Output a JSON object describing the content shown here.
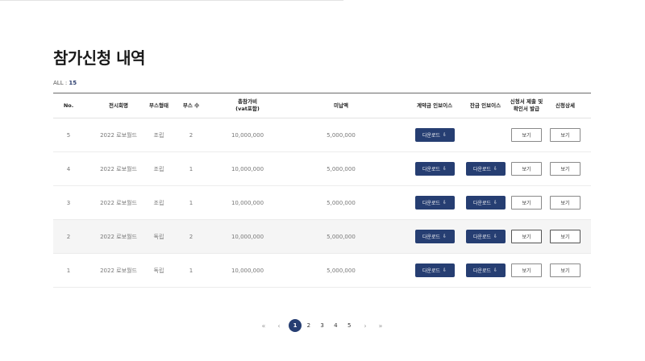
{
  "page": {
    "title": "참가신청 내역"
  },
  "summary": {
    "label": "ALL : ",
    "count": "15"
  },
  "table": {
    "headers": {
      "no": "No.",
      "name": "전시회명",
      "type": "부스형태",
      "count": "부스 수",
      "total_line1": "총참가비",
      "total_line2": "(vat포함)",
      "unpaid": "미납액",
      "inv1": "계약금 인보이스",
      "inv2": "잔금 인보이스",
      "apply_line1": "신청서 제출 및",
      "apply_line2": "확인서 발급",
      "detail": "신청상세"
    },
    "rows": [
      {
        "no": "5",
        "name": "2022 로보월드",
        "type": "조립",
        "count": "2",
        "total": "10,000,000",
        "unpaid": "5,000,000",
        "inv1": "다운로드",
        "inv2": "",
        "apply": "보기",
        "detail": "보기"
      },
      {
        "no": "4",
        "name": "2022 로보월드",
        "type": "조립",
        "count": "1",
        "total": "10,000,000",
        "unpaid": "5,000,000",
        "inv1": "다운로드",
        "inv2": "다운로드",
        "apply": "보기",
        "detail": "보기"
      },
      {
        "no": "3",
        "name": "2022 로보월드",
        "type": "조립",
        "count": "1",
        "total": "10,000,000",
        "unpaid": "5,000,000",
        "inv1": "다운로드",
        "inv2": "다운로드",
        "apply": "보기",
        "detail": "보기"
      },
      {
        "no": "2",
        "name": "2022 로보월드",
        "type": "독립",
        "count": "2",
        "total": "10,000,000",
        "unpaid": "5,000,000",
        "inv1": "다운로드",
        "inv2": "다운로드",
        "apply": "보기",
        "detail": "보기"
      },
      {
        "no": "1",
        "name": "2022 로보월드",
        "type": "독립",
        "count": "1",
        "total": "10,000,000",
        "unpaid": "5,000,000",
        "inv1": "다운로드",
        "inv2": "다운로드",
        "apply": "보기",
        "detail": "보기"
      }
    ]
  },
  "icons": {
    "download": "download-icon"
  },
  "pagination": {
    "first": "«",
    "prev": "‹",
    "pages": [
      "1",
      "2",
      "3",
      "4",
      "5"
    ],
    "current": "1",
    "next": "›",
    "last": "»"
  },
  "colors": {
    "accent": "#263e72"
  }
}
